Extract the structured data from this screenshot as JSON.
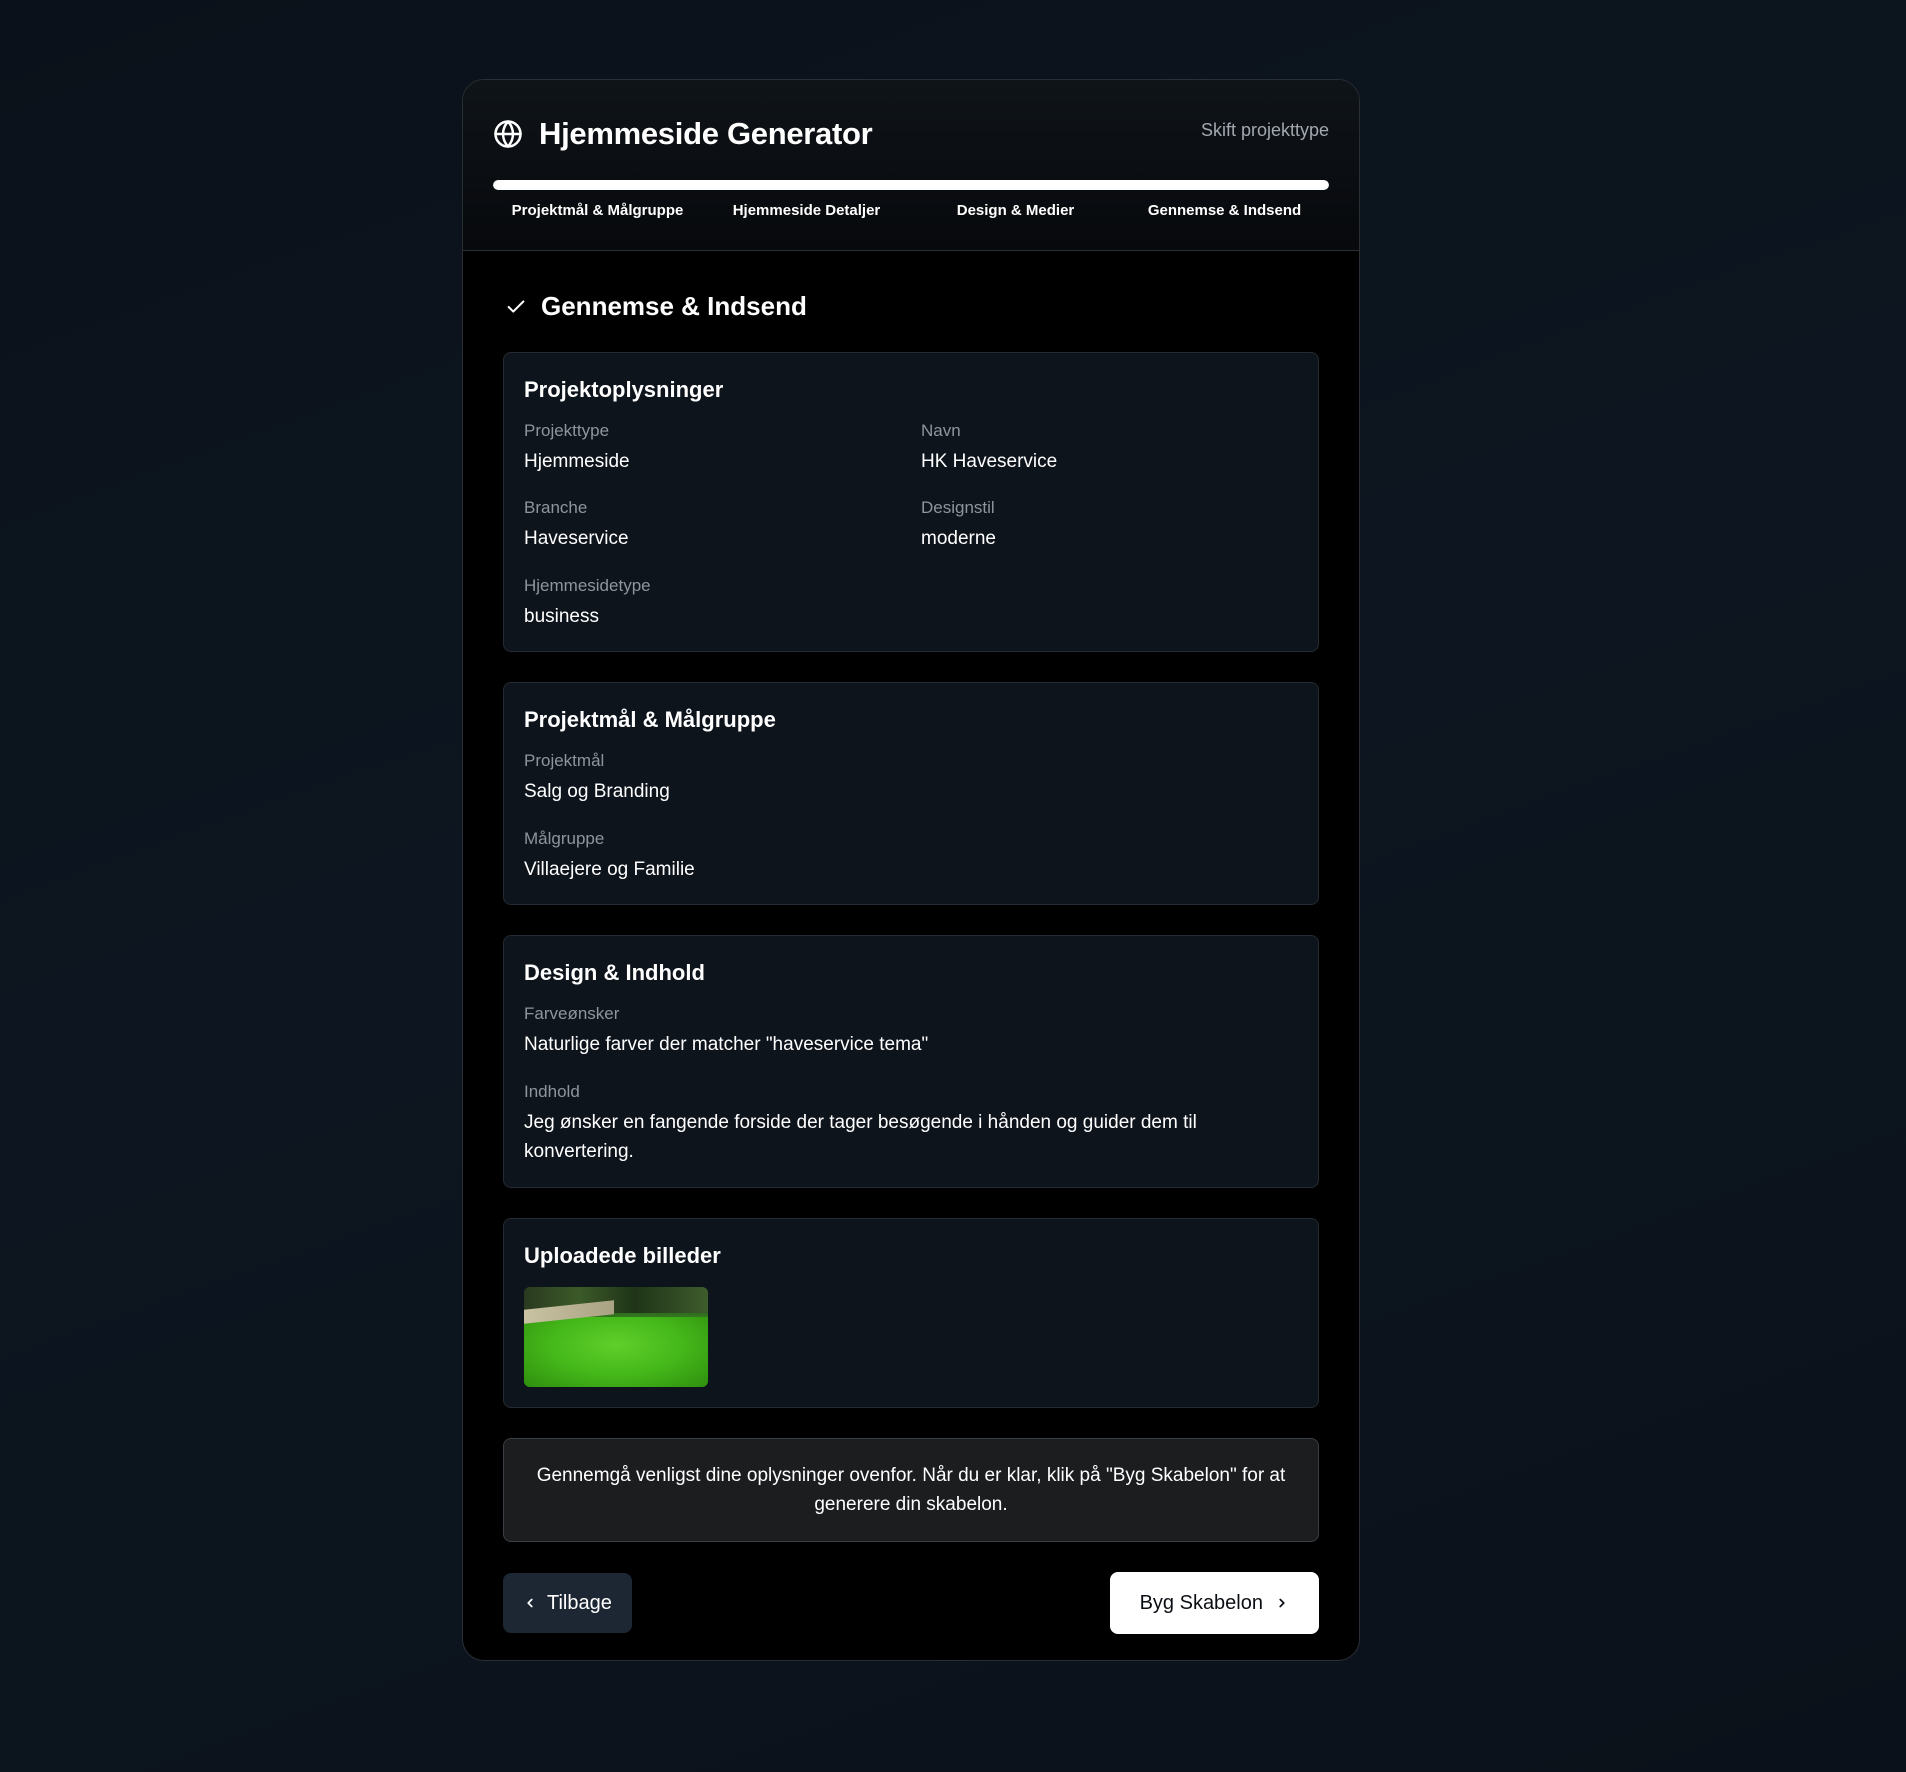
{
  "header": {
    "title": "Hjemmeside Generator",
    "icon": "globe-icon",
    "switch_link": "Skift projekttype",
    "progress_fraction": 1.0,
    "steps": [
      {
        "label": "Projektmål & Målgruppe"
      },
      {
        "label": "Hjemmeside Detaljer"
      },
      {
        "label": "Design & Medier"
      },
      {
        "label": "Gennemse & Indsend"
      }
    ]
  },
  "section": {
    "title": "Gennemse & Indsend",
    "icon": "check-icon"
  },
  "project_info": {
    "title": "Projektoplysninger",
    "fields": [
      {
        "label": "Projekttype",
        "value": "Hjemmeside"
      },
      {
        "label": "Navn",
        "value": "HK Haveservice"
      },
      {
        "label": "Branche",
        "value": "Haveservice"
      },
      {
        "label": "Designstil",
        "value": "moderne"
      },
      {
        "label": "Hjemmesidetype",
        "value": "business"
      }
    ]
  },
  "goals": {
    "title": "Projektmål & Målgruppe",
    "fields": [
      {
        "label": "Projektmål",
        "value": "Salg og Branding"
      },
      {
        "label": "Målgruppe",
        "value": "Villaejere og Familie"
      }
    ]
  },
  "design": {
    "title": "Design & Indhold",
    "fields": [
      {
        "label": "Farveønsker",
        "value": "Naturlige farver der matcher \"haveservice tema\""
      },
      {
        "label": "Indhold",
        "value": "Jeg ønsker en fangende forside der tager besøgende i hånden og guider dem til konvertering."
      }
    ]
  },
  "uploads": {
    "title": "Uploadede billeder"
  },
  "notice": "Gennemgå venligst dine oplysninger ovenfor. Når du er klar, klik på \"Byg Skabelon\" for at generere din skabelon.",
  "actions": {
    "back_label": "Tilbage",
    "build_label": "Byg Skabelon"
  },
  "colors": {
    "background": "#0d1620",
    "card": "#000000",
    "panel": "#0e141c",
    "accent": "#ffffff",
    "back_button": "#1d2733"
  }
}
